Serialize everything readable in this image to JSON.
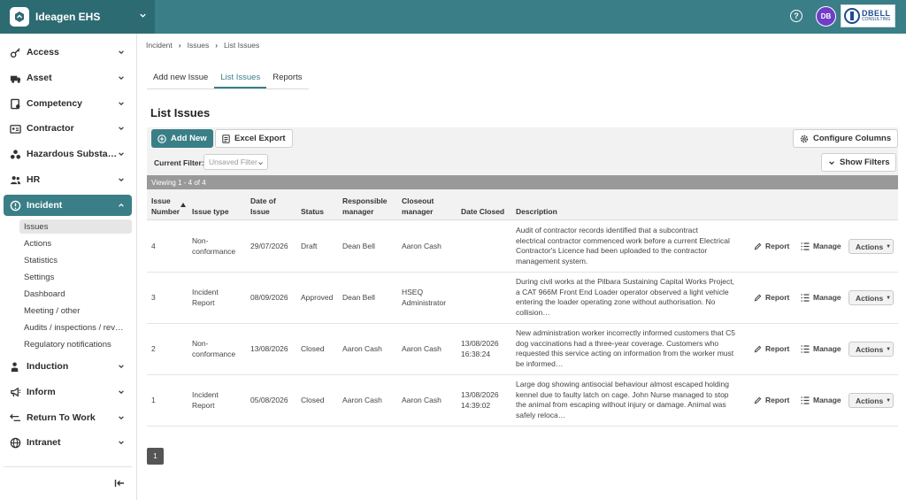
{
  "app": {
    "name": "Ideagen EHS"
  },
  "user": {
    "initials": "DB"
  },
  "company_logo": {
    "name": "DBELL",
    "sub": "CONSULTING"
  },
  "sidebar": {
    "items": [
      {
        "label": "Access",
        "icon": "key-icon"
      },
      {
        "label": "Asset",
        "icon": "truck-icon"
      },
      {
        "label": "Competency",
        "icon": "certificate-icon"
      },
      {
        "label": "Contractor",
        "icon": "id-card-icon"
      },
      {
        "label": "Hazardous Substa…",
        "icon": "biohazard-icon"
      },
      {
        "label": "HR",
        "icon": "users-icon"
      },
      {
        "label": "Incident",
        "icon": "alert-icon",
        "active": true
      },
      {
        "label": "Induction",
        "icon": "user-check-icon"
      },
      {
        "label": "Inform",
        "icon": "megaphone-icon"
      },
      {
        "label": "Return To Work",
        "icon": "arrows-icon"
      },
      {
        "label": "Intranet",
        "icon": "globe-icon"
      }
    ],
    "incident_sub": [
      "Issues",
      "Actions",
      "Statistics",
      "Settings",
      "Dashboard",
      "Meeting / other",
      "Audits / inspections / rev…",
      "Regulatory notifications"
    ]
  },
  "breadcrumb": [
    "Incident",
    "Issues",
    "List Issues"
  ],
  "tabs": [
    "Add new Issue",
    "List Issues",
    "Reports"
  ],
  "page_title": "List Issues",
  "toolbar": {
    "add_new": "Add New",
    "excel_export": "Excel Export",
    "configure_columns": "Configure Columns",
    "show_filters": "Show Filters",
    "current_filter_label": "Current Filter:",
    "current_filter_value": "Unsaved Filter"
  },
  "viewing": "Viewing 1 - 4 of 4",
  "table": {
    "headers": {
      "issue_number": [
        "Issue",
        "Number"
      ],
      "issue_type": "Issue type",
      "date_of_issue": [
        "Date of",
        "Issue"
      ],
      "status": "Status",
      "responsible_manager": [
        "Responsible",
        "manager"
      ],
      "closeout_manager": [
        "Closeout",
        "manager"
      ],
      "date_closed": "Date Closed",
      "description": "Description"
    },
    "row_actions": {
      "report": "Report",
      "manage": "Manage",
      "actions": "Actions"
    },
    "rows": [
      {
        "number": "4",
        "type": [
          "Non-",
          "conformance"
        ],
        "date": "29/07/2026",
        "status": "Draft",
        "responsible": "Dean Bell",
        "closeout": [
          "Aaron Cash"
        ],
        "closed": [
          "",
          ""
        ],
        "description": [
          "Audit of contractor records identified that a subcontract",
          "electrical contractor commenced work before a current Electrical",
          "Contractor's Licence had been uploaded to the contractor",
          "management system."
        ]
      },
      {
        "number": "3",
        "type": [
          "Incident",
          "Report"
        ],
        "date": "08/09/2026",
        "status": "Approved",
        "responsible": "Dean Bell",
        "closeout": [
          "HSEQ",
          "Administrator"
        ],
        "closed": [
          "",
          ""
        ],
        "description": [
          "During civil works at the Pilbara Sustaining Capital Works Project,",
          "a CAT 966M Front End Loader operator observed a light vehicle",
          "entering the loader operating zone without authorisation. No",
          "collision…"
        ]
      },
      {
        "number": "2",
        "type": [
          "Non-",
          "conformance"
        ],
        "date": "13/08/2026",
        "status": "Closed",
        "responsible": "Aaron Cash",
        "closeout": [
          "Aaron Cash"
        ],
        "closed": [
          "13/08/2026",
          "16:38:24"
        ],
        "description": [
          "New administration worker incorrectly informed customers that C5",
          "dog vaccinations had a three-year coverage. Customers who",
          "requested this service acting on information from the worker must",
          "be informed…"
        ]
      },
      {
        "number": "1",
        "type": [
          "Incident",
          "Report"
        ],
        "date": "05/08/2026",
        "status": "Closed",
        "responsible": "Aaron Cash",
        "closeout": [
          "Aaron Cash"
        ],
        "closed": [
          "13/08/2026",
          "14:39:02"
        ],
        "description": [
          "Large dog showing antisocial behaviour almost escaped holding",
          "kennel due to faulty latch on cage. John Nurse managed to stop",
          "the animal from escaping without injury or damage. Animal was",
          "safely reloca…"
        ]
      }
    ]
  },
  "pagination": {
    "current": "1"
  },
  "colors": {
    "primary": "#3a7f87",
    "brand_dark": "#2d6b73",
    "avatar": "#6f3dc9"
  }
}
